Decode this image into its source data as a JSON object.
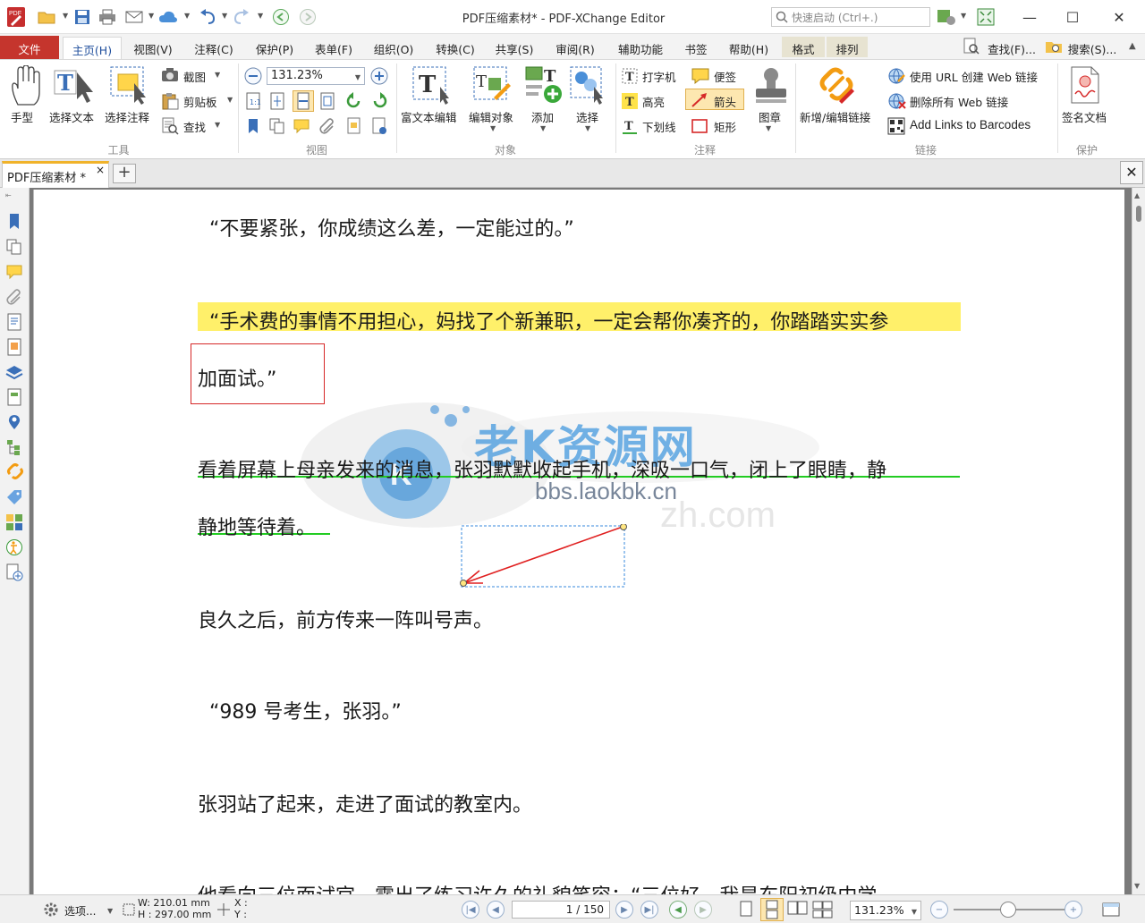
{
  "window": {
    "title": "PDF压缩素材* - PDF-XChange Editor",
    "search_placeholder": "快速启动 (Ctrl+.)",
    "minimize": "—",
    "maximize": "☐",
    "close": "✕"
  },
  "menu": {
    "file": "文件",
    "items": [
      "主页(H)",
      "视图(V)",
      "注释(C)",
      "保护(P)",
      "表单(F)",
      "组织(O)",
      "转换(C)",
      "共享(S)",
      "审阅(R)",
      "辅助功能",
      "书签",
      "帮助(H)"
    ],
    "context": [
      "格式",
      "排列"
    ],
    "find": "查找(F)...",
    "search": "搜索(S)..."
  },
  "ribbon": {
    "tools": {
      "hand": "手型",
      "select_text": "选择文本",
      "select_annot": "选择注释",
      "snapshot": "截图",
      "clipboard": "剪贴板",
      "find": "查找",
      "group": "工具"
    },
    "view": {
      "zoom": "131.23%",
      "group": "视图"
    },
    "objects": {
      "edit_rich": "富文本编辑",
      "edit_obj": "编辑对象",
      "add": "添加",
      "select": "选择",
      "group": "对象"
    },
    "comment": {
      "typewriter": "打字机",
      "note": "便签",
      "highlight": "高亮",
      "arrow": "箭头",
      "underline": "下划线",
      "rectangle": "矩形",
      "stamp": "图章",
      "group": "注释"
    },
    "links": {
      "add_edit": "新增/编辑链接",
      "create_web": "使用 URL 创建 Web 链接",
      "delete_web": "删除所有 Web 链接",
      "barcodes": "Add Links to Barcodes",
      "group": "链接"
    },
    "protect": {
      "sign": "签名文档",
      "group": "保护"
    }
  },
  "tabs": {
    "doc": "PDF压缩素材 *",
    "close": "×",
    "new": "+"
  },
  "document": {
    "lines": [
      "“不要紧张，你成绩这么差，一定能过的。”",
      "“手术费的事情不用担心，妈找了个新兼职，一定会帮你凑齐的，你踏踏实实参",
      "加面试。”",
      "看着屏幕上母亲发来的消息，张羽默默收起手机，深吸一口气，闭上了眼睛，静",
      "静地等待着。",
      "良久之后，前方传来一阵叫号声。",
      "“989 号考生，张羽。”",
      "张羽站了起来，走进了面试的教室内。",
      "他看向三位面试官，露出了练习许久的礼貌笑容：“三位好，我是东阳初级中学"
    ],
    "watermark_title": "老K资源网",
    "watermark_url": "bbs.laokbk.cn",
    "watermark_ghost": "zh.com",
    "highlight_color": "#fff06a",
    "rect_color": "#d62828",
    "underline_color": "#22cc22",
    "arrow_color": "#e02020"
  },
  "status": {
    "options": "选项...",
    "width": "W: 210.01 mm",
    "height": "H : 297.00 mm",
    "x": "X :",
    "y": "Y :",
    "page": "1",
    "pages": "150",
    "zoom": "131.23%"
  }
}
